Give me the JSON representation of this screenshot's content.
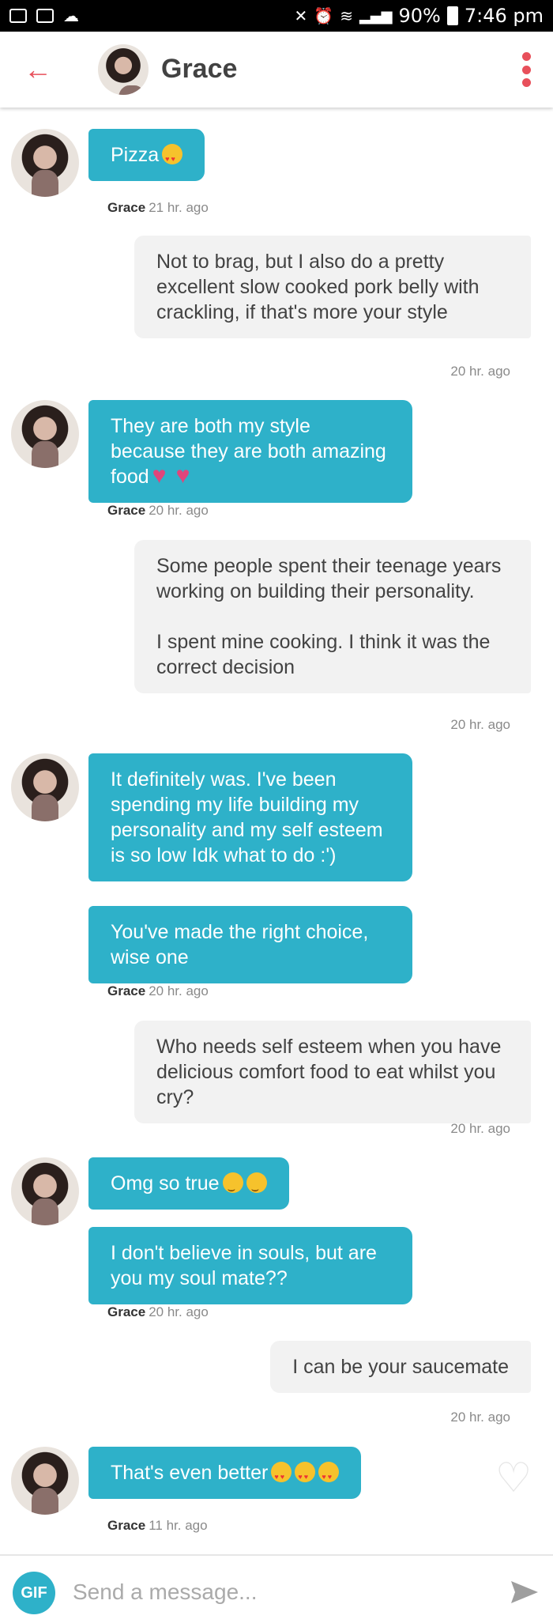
{
  "status_bar": {
    "battery": "90%",
    "time": "7:46 pm"
  },
  "header": {
    "name": "Grace"
  },
  "messages": [
    {
      "text": "Pizza",
      "sender": "Grace",
      "time": "21 hr. ago"
    },
    {
      "text": "Not to brag, but I also do a pretty excellent slow cooked pork belly with crackling, if that's more your style",
      "time": "20 hr. ago"
    },
    {
      "text": "They are both my style because they are both amazing food",
      "sender": "Grace",
      "time": "20 hr. ago"
    },
    {
      "text_1": "Some people spent their teenage years working on building their personality.",
      "text_2": "I spent mine cooking. I think it was the correct decision",
      "time": "20 hr. ago"
    },
    {
      "text": "It definitely was. I've been spending my life building my personality and my self esteem is so low Idk what to do :')"
    },
    {
      "text": "You've made the right choice, wise one",
      "sender": "Grace",
      "time": "20 hr. ago"
    },
    {
      "text": "Who needs self esteem when you have delicious comfort food to eat whilst you cry?",
      "time": "20 hr. ago"
    },
    {
      "text": "Omg so true"
    },
    {
      "text": "I don't believe in souls, but are you my soul mate??",
      "sender": "Grace",
      "time": "20 hr. ago"
    },
    {
      "text": "I can be your saucemate",
      "time": "20 hr. ago"
    },
    {
      "text": "That's even better",
      "sender": "Grace",
      "time": "11 hr. ago"
    }
  ],
  "composer": {
    "gif_label": "GIF",
    "placeholder": "Send a message..."
  },
  "colors": {
    "accent": "#e8505b",
    "bubble_in": "#2eb1c9",
    "bubble_out": "#f2f2f2"
  }
}
